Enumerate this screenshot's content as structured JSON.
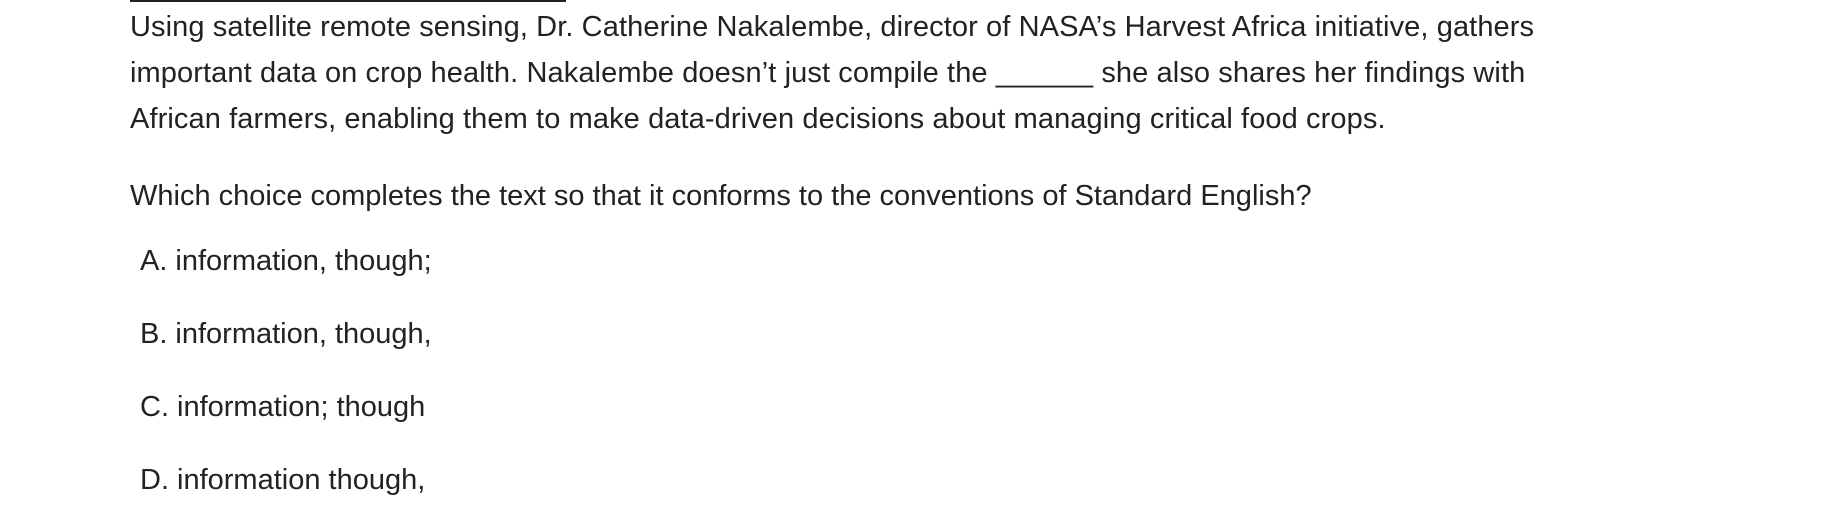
{
  "passage": {
    "lines": [
      "Using satellite remote sensing, Dr. Catherine Nakalembe, director of NASA’s Harvest Africa initiative, gathers",
      "important data on crop health. Nakalembe doesn’t just compile the ______ she also shares her findings with",
      "African farmers, enabling them to make data-driven decisions about managing critical food crops."
    ]
  },
  "question": {
    "text": "Which choice completes the text so that it conforms to the conventions of Standard English?"
  },
  "choices": [
    {
      "letter": "A.",
      "text": "information, though;"
    },
    {
      "letter": "B.",
      "text": "information, though,"
    },
    {
      "letter": "C.",
      "text": "information; though"
    },
    {
      "letter": "D.",
      "text": "information though,"
    }
  ]
}
